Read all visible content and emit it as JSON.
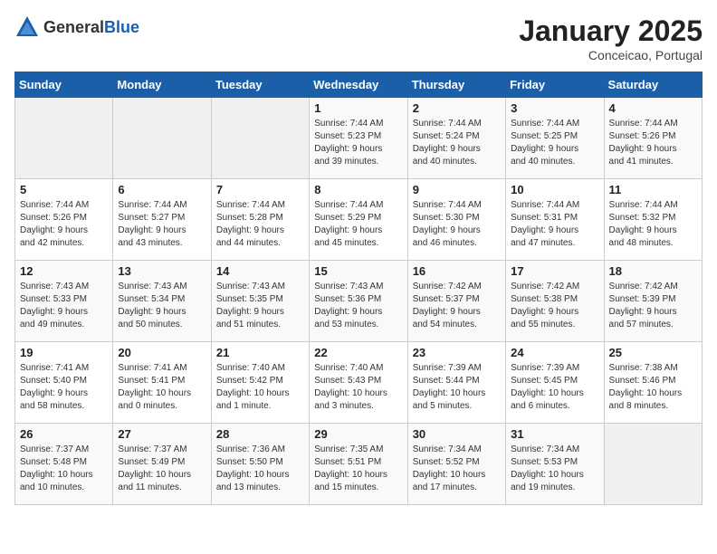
{
  "header": {
    "logo_general": "General",
    "logo_blue": "Blue",
    "title": "January 2025",
    "location": "Conceicao, Portugal"
  },
  "days_of_week": [
    "Sunday",
    "Monday",
    "Tuesday",
    "Wednesday",
    "Thursday",
    "Friday",
    "Saturday"
  ],
  "weeks": [
    {
      "days": [
        {
          "number": "",
          "info": ""
        },
        {
          "number": "",
          "info": ""
        },
        {
          "number": "",
          "info": ""
        },
        {
          "number": "1",
          "info": "Sunrise: 7:44 AM\nSunset: 5:23 PM\nDaylight: 9 hours\nand 39 minutes."
        },
        {
          "number": "2",
          "info": "Sunrise: 7:44 AM\nSunset: 5:24 PM\nDaylight: 9 hours\nand 40 minutes."
        },
        {
          "number": "3",
          "info": "Sunrise: 7:44 AM\nSunset: 5:25 PM\nDaylight: 9 hours\nand 40 minutes."
        },
        {
          "number": "4",
          "info": "Sunrise: 7:44 AM\nSunset: 5:26 PM\nDaylight: 9 hours\nand 41 minutes."
        }
      ]
    },
    {
      "days": [
        {
          "number": "5",
          "info": "Sunrise: 7:44 AM\nSunset: 5:26 PM\nDaylight: 9 hours\nand 42 minutes."
        },
        {
          "number": "6",
          "info": "Sunrise: 7:44 AM\nSunset: 5:27 PM\nDaylight: 9 hours\nand 43 minutes."
        },
        {
          "number": "7",
          "info": "Sunrise: 7:44 AM\nSunset: 5:28 PM\nDaylight: 9 hours\nand 44 minutes."
        },
        {
          "number": "8",
          "info": "Sunrise: 7:44 AM\nSunset: 5:29 PM\nDaylight: 9 hours\nand 45 minutes."
        },
        {
          "number": "9",
          "info": "Sunrise: 7:44 AM\nSunset: 5:30 PM\nDaylight: 9 hours\nand 46 minutes."
        },
        {
          "number": "10",
          "info": "Sunrise: 7:44 AM\nSunset: 5:31 PM\nDaylight: 9 hours\nand 47 minutes."
        },
        {
          "number": "11",
          "info": "Sunrise: 7:44 AM\nSunset: 5:32 PM\nDaylight: 9 hours\nand 48 minutes."
        }
      ]
    },
    {
      "days": [
        {
          "number": "12",
          "info": "Sunrise: 7:43 AM\nSunset: 5:33 PM\nDaylight: 9 hours\nand 49 minutes."
        },
        {
          "number": "13",
          "info": "Sunrise: 7:43 AM\nSunset: 5:34 PM\nDaylight: 9 hours\nand 50 minutes."
        },
        {
          "number": "14",
          "info": "Sunrise: 7:43 AM\nSunset: 5:35 PM\nDaylight: 9 hours\nand 51 minutes."
        },
        {
          "number": "15",
          "info": "Sunrise: 7:43 AM\nSunset: 5:36 PM\nDaylight: 9 hours\nand 53 minutes."
        },
        {
          "number": "16",
          "info": "Sunrise: 7:42 AM\nSunset: 5:37 PM\nDaylight: 9 hours\nand 54 minutes."
        },
        {
          "number": "17",
          "info": "Sunrise: 7:42 AM\nSunset: 5:38 PM\nDaylight: 9 hours\nand 55 minutes."
        },
        {
          "number": "18",
          "info": "Sunrise: 7:42 AM\nSunset: 5:39 PM\nDaylight: 9 hours\nand 57 minutes."
        }
      ]
    },
    {
      "days": [
        {
          "number": "19",
          "info": "Sunrise: 7:41 AM\nSunset: 5:40 PM\nDaylight: 9 hours\nand 58 minutes."
        },
        {
          "number": "20",
          "info": "Sunrise: 7:41 AM\nSunset: 5:41 PM\nDaylight: 10 hours\nand 0 minutes."
        },
        {
          "number": "21",
          "info": "Sunrise: 7:40 AM\nSunset: 5:42 PM\nDaylight: 10 hours\nand 1 minute."
        },
        {
          "number": "22",
          "info": "Sunrise: 7:40 AM\nSunset: 5:43 PM\nDaylight: 10 hours\nand 3 minutes."
        },
        {
          "number": "23",
          "info": "Sunrise: 7:39 AM\nSunset: 5:44 PM\nDaylight: 10 hours\nand 5 minutes."
        },
        {
          "number": "24",
          "info": "Sunrise: 7:39 AM\nSunset: 5:45 PM\nDaylight: 10 hours\nand 6 minutes."
        },
        {
          "number": "25",
          "info": "Sunrise: 7:38 AM\nSunset: 5:46 PM\nDaylight: 10 hours\nand 8 minutes."
        }
      ]
    },
    {
      "days": [
        {
          "number": "26",
          "info": "Sunrise: 7:37 AM\nSunset: 5:48 PM\nDaylight: 10 hours\nand 10 minutes."
        },
        {
          "number": "27",
          "info": "Sunrise: 7:37 AM\nSunset: 5:49 PM\nDaylight: 10 hours\nand 11 minutes."
        },
        {
          "number": "28",
          "info": "Sunrise: 7:36 AM\nSunset: 5:50 PM\nDaylight: 10 hours\nand 13 minutes."
        },
        {
          "number": "29",
          "info": "Sunrise: 7:35 AM\nSunset: 5:51 PM\nDaylight: 10 hours\nand 15 minutes."
        },
        {
          "number": "30",
          "info": "Sunrise: 7:34 AM\nSunset: 5:52 PM\nDaylight: 10 hours\nand 17 minutes."
        },
        {
          "number": "31",
          "info": "Sunrise: 7:34 AM\nSunset: 5:53 PM\nDaylight: 10 hours\nand 19 minutes."
        },
        {
          "number": "",
          "info": ""
        }
      ]
    }
  ]
}
